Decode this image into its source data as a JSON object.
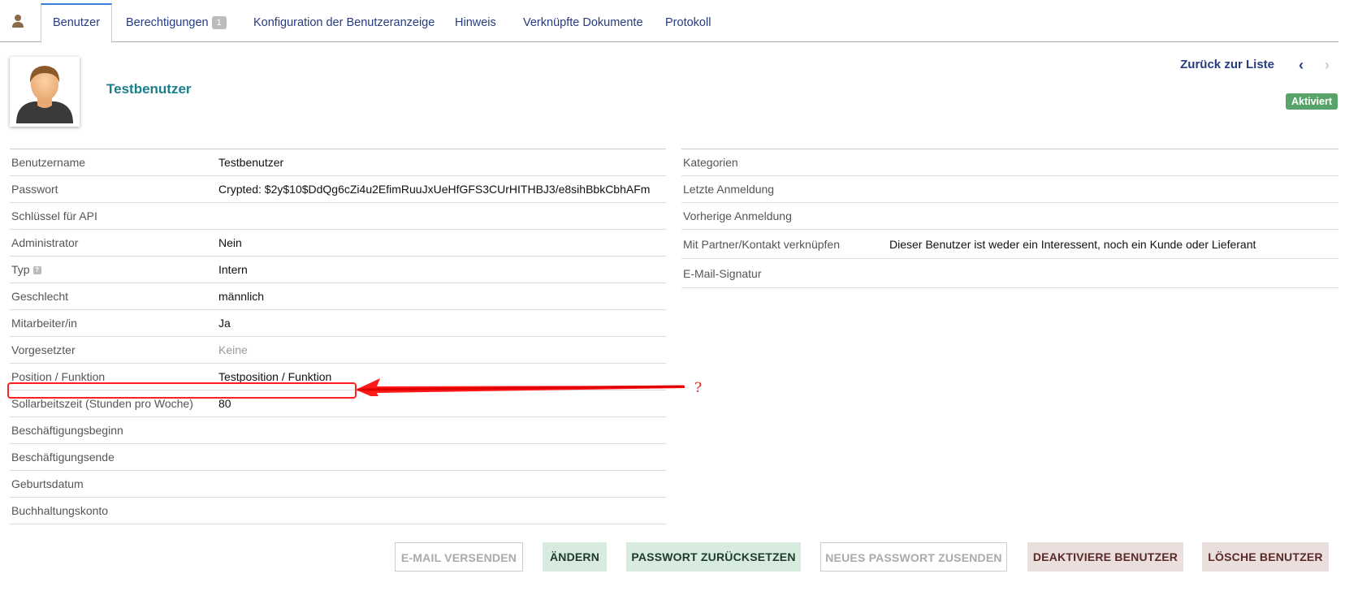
{
  "tabs": [
    {
      "label": "Benutzer",
      "active": true
    },
    {
      "label": "Berechtigungen",
      "badge": "1"
    },
    {
      "label": "Konfiguration der Benutzeranzeige"
    },
    {
      "label": "Hinweis"
    },
    {
      "label": "Verknüpfte Dokumente"
    },
    {
      "label": "Protokoll"
    }
  ],
  "header": {
    "title": "Testbenutzer",
    "back_label": "Zurück zur Liste",
    "prev_icon": "‹",
    "next_icon": "›",
    "status": "Aktiviert"
  },
  "left_fields": [
    {
      "label": "Benutzername",
      "value": "Testbenutzer"
    },
    {
      "label": "Passwort",
      "value": "Crypted: $2y$10$DdQg6cZi4u2EfimRuuJxUeHfGFS3CUrHITHBJ3/e8sihBbkCbhAFm"
    },
    {
      "label": "Schlüssel für API",
      "value": ""
    },
    {
      "label": "Administrator",
      "value": "Nein"
    },
    {
      "label": "Typ",
      "value": "Intern",
      "help": "?"
    },
    {
      "label": "Geschlecht",
      "value": "männlich"
    },
    {
      "label": "Mitarbeiter/in",
      "value": "Ja"
    },
    {
      "label": "Vorgesetzter",
      "value": "Keine"
    },
    {
      "label": "Position / Funktion",
      "value": "Testposition / Funktion"
    },
    {
      "label": "Sollarbeitszeit (Stunden pro Woche)",
      "value": "80"
    },
    {
      "label": "Beschäftigungsbeginn",
      "value": ""
    },
    {
      "label": "Beschäftigungsende",
      "value": ""
    },
    {
      "label": "Geburtsdatum",
      "value": ""
    },
    {
      "label": "Buchhaltungskonto",
      "value": ""
    }
  ],
  "right_fields": [
    {
      "label": "Kategorien",
      "value": ""
    },
    {
      "label": "Letzte Anmeldung",
      "value": ""
    },
    {
      "label": "Vorherige Anmeldung",
      "value": ""
    },
    {
      "label": "Mit Partner/Kontakt verknüpfen",
      "value": "Dieser Benutzer ist weder ein Interessent, noch ein Kunde oder Lieferant"
    },
    {
      "label": "E-Mail-Signatur",
      "value": ""
    }
  ],
  "annotation": {
    "mark": "?"
  },
  "buttons": {
    "send_email": "E-MAIL VERSENDEN",
    "edit": "ÄNDERN",
    "reset_password": "PASSWORT ZURÜCKSETZEN",
    "send_new_password": "NEUES PASSWORT ZUSENDEN",
    "deactivate": "DEAKTIVIERE BENUTZER",
    "delete": "LÖSCHE BENUTZER"
  },
  "colors": {
    "accent": "#263c81",
    "title": "#1a7f8a",
    "status": "#58a36a",
    "annotation": "#ff2020"
  }
}
